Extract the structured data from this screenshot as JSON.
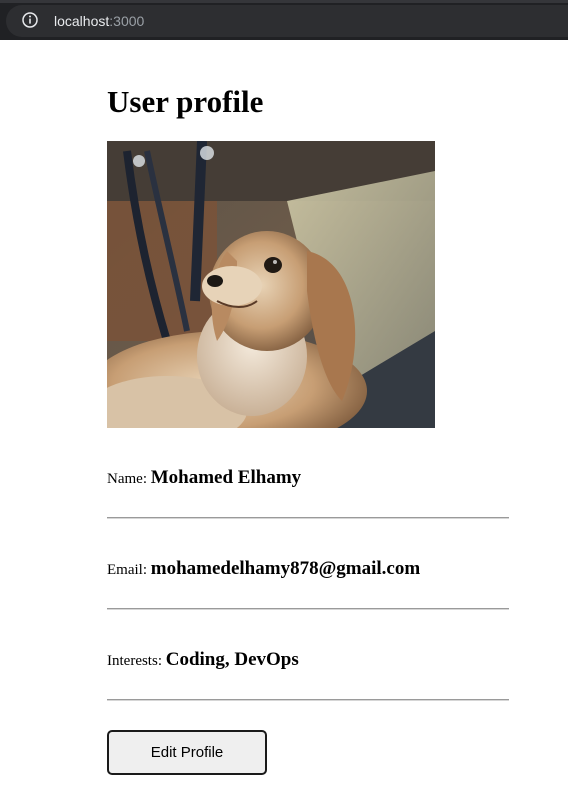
{
  "browser": {
    "url_host": "localhost",
    "url_port": ":3000"
  },
  "profile": {
    "title": "User profile",
    "fields": [
      {
        "label": "Name:",
        "value": "Mohamed Elhamy"
      },
      {
        "label": "Email:",
        "value": "mohamedelhamy878@gmail.com"
      },
      {
        "label": "Interests:",
        "value": "Coding, DevOps"
      }
    ],
    "edit_button_label": "Edit Profile"
  }
}
